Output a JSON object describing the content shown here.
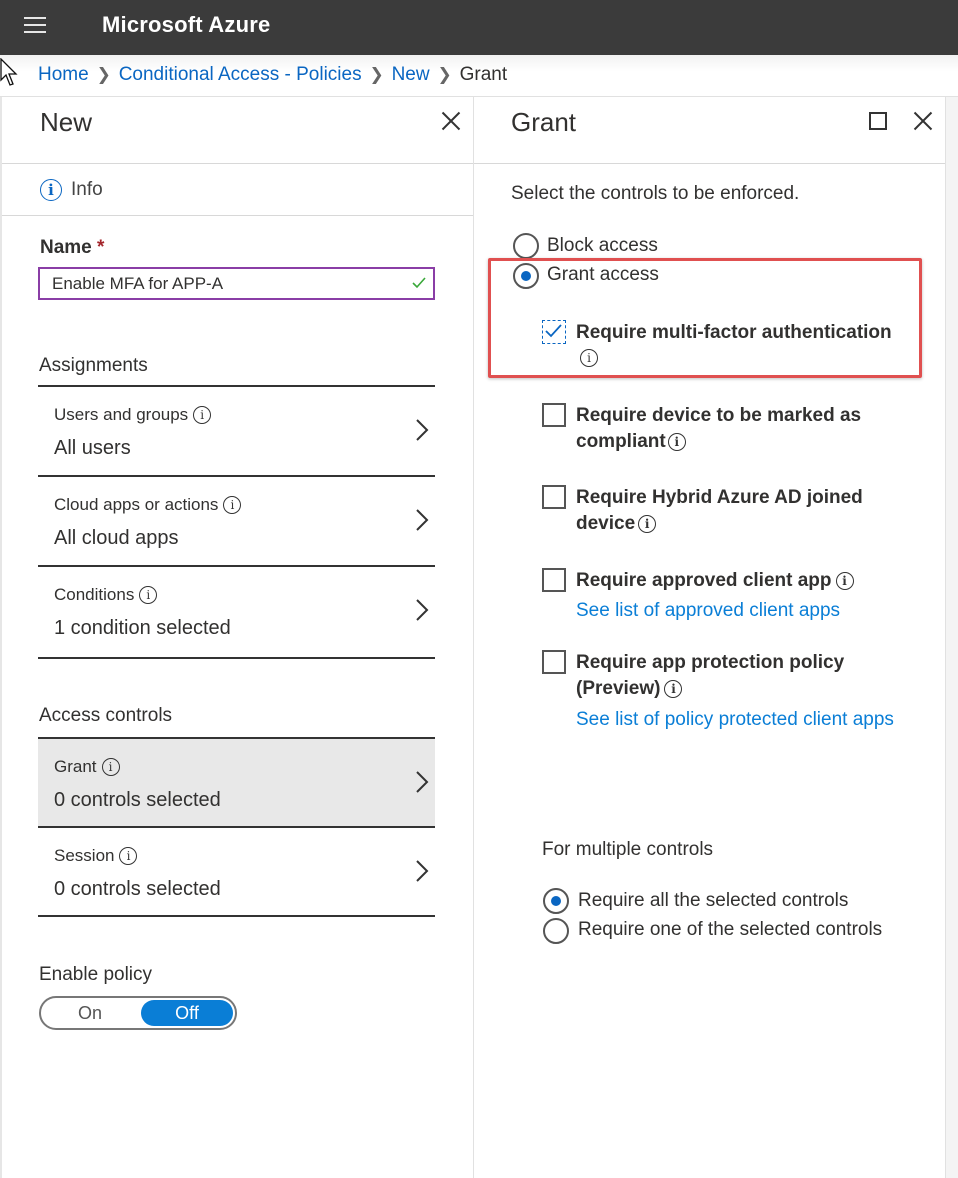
{
  "app": {
    "title": "Microsoft Azure"
  },
  "breadcrumb": [
    {
      "label": "Home"
    },
    {
      "label": "Conditional Access - Policies"
    },
    {
      "label": "New"
    },
    {
      "label": "Grant"
    }
  ],
  "left_blade": {
    "title": "New",
    "info_label": "Info",
    "name_label": "Name",
    "name_required": "*",
    "name_value": "Enable MFA for APP-A",
    "assignments_heading": "Assignments",
    "assignments": [
      {
        "title": "Users and groups",
        "value": "All users"
      },
      {
        "title": "Cloud apps or actions",
        "value": "All cloud apps"
      },
      {
        "title": "Conditions",
        "value": "1 condition selected"
      }
    ],
    "access_controls_heading": "Access controls",
    "access_controls": [
      {
        "title": "Grant",
        "value": "0 controls selected",
        "active": true
      },
      {
        "title": "Session",
        "value": "0 controls selected"
      }
    ],
    "enable_policy_label": "Enable policy",
    "toggle": {
      "on_label": "On",
      "off_label": "Off",
      "selected": "Off"
    }
  },
  "right_blade": {
    "title": "Grant",
    "instruction": "Select the controls to be enforced.",
    "radios": [
      {
        "label": "Block access",
        "selected": false
      },
      {
        "label": "Grant access",
        "selected": true
      }
    ],
    "controls": [
      {
        "line1": "Require multi-factor authentication",
        "line2": "",
        "checked": true
      },
      {
        "line1": "Require device to be marked as",
        "line2": "compliant",
        "checked": false
      },
      {
        "line1": "Require Hybrid Azure AD joined",
        "line2": "device",
        "checked": false
      },
      {
        "line1": "Require approved client app",
        "line2": "",
        "checked": false,
        "link": "See list of approved client apps"
      },
      {
        "line1": "Require app protection policy",
        "line2": "(Preview)",
        "checked": false,
        "link": "See list of policy protected client apps"
      }
    ],
    "multiple_controls_label": "For multiple controls",
    "multiple_options": [
      {
        "label": "Require all the selected controls",
        "selected": true
      },
      {
        "label": "Require one of the selected controls",
        "selected": false
      }
    ]
  },
  "colors": {
    "accent": "#0a66c2",
    "toggle_active": "#0a7ed6",
    "highlight_box": "#e05050",
    "topbar": "#3b3b3b"
  }
}
